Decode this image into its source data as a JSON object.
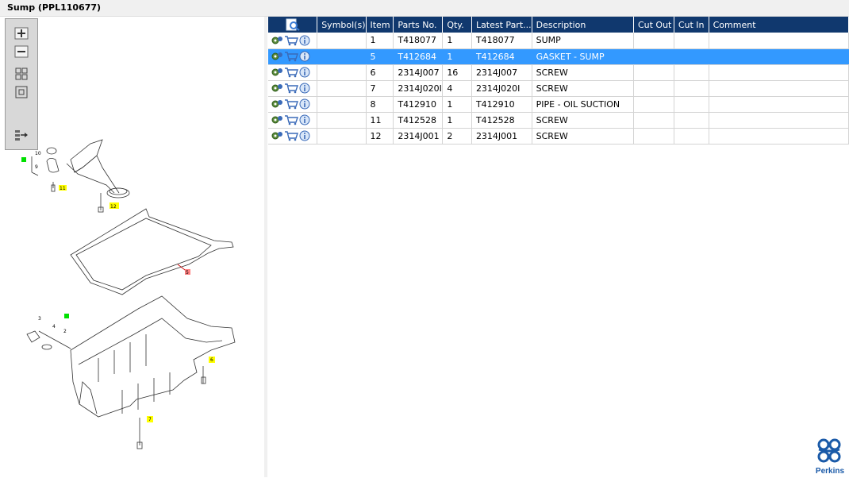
{
  "window": {
    "title": "Sump (PPL110677)"
  },
  "toolbar": {
    "buttons": [
      {
        "icon": "zoom-in-icon"
      },
      {
        "icon": "zoom-out-icon"
      },
      {
        "icon": "fit-all-icon"
      },
      {
        "icon": "actual-size-icon"
      },
      {
        "icon": "export-icon"
      }
    ]
  },
  "grid": {
    "headers": [
      "",
      "Symbol(s)",
      "Item",
      "Parts No.",
      "Qty.",
      "Latest Part...",
      "Description",
      "Cut Out",
      "Cut In",
      "Comment"
    ],
    "selected_row": 1,
    "rows": [
      {
        "item": "1",
        "part_no": "T418077",
        "qty": "1",
        "latest": "T418077",
        "description": "SUMP"
      },
      {
        "item": "5",
        "part_no": "T412684",
        "qty": "1",
        "latest": "T412684",
        "description": "GASKET - SUMP"
      },
      {
        "item": "6",
        "part_no": "2314J007",
        "qty": "16",
        "latest": "2314J007",
        "description": "SCREW"
      },
      {
        "item": "7",
        "part_no": "2314J020I",
        "qty": "4",
        "latest": "2314J020I",
        "description": "SCREW"
      },
      {
        "item": "8",
        "part_no": "T412910",
        "qty": "1",
        "latest": "T412910",
        "description": "PIPE - OIL SUCTION"
      },
      {
        "item": "11",
        "part_no": "T412528",
        "qty": "1",
        "latest": "T412528",
        "description": "SCREW"
      },
      {
        "item": "12",
        "part_no": "2314J001",
        "qty": "2",
        "latest": "2314J001",
        "description": "SCREW"
      }
    ]
  },
  "diagram": {
    "callouts": [
      "10",
      "9",
      "11",
      "12",
      "5",
      "3",
      "4",
      "2",
      "6",
      "7"
    ]
  },
  "logo": {
    "text": "Perkins"
  },
  "colors": {
    "header": "#10386e",
    "selection": "#3399ff",
    "callout_yellow": "#ffff00",
    "callout_green": "#00e000",
    "callout_red": "#ff8080"
  }
}
